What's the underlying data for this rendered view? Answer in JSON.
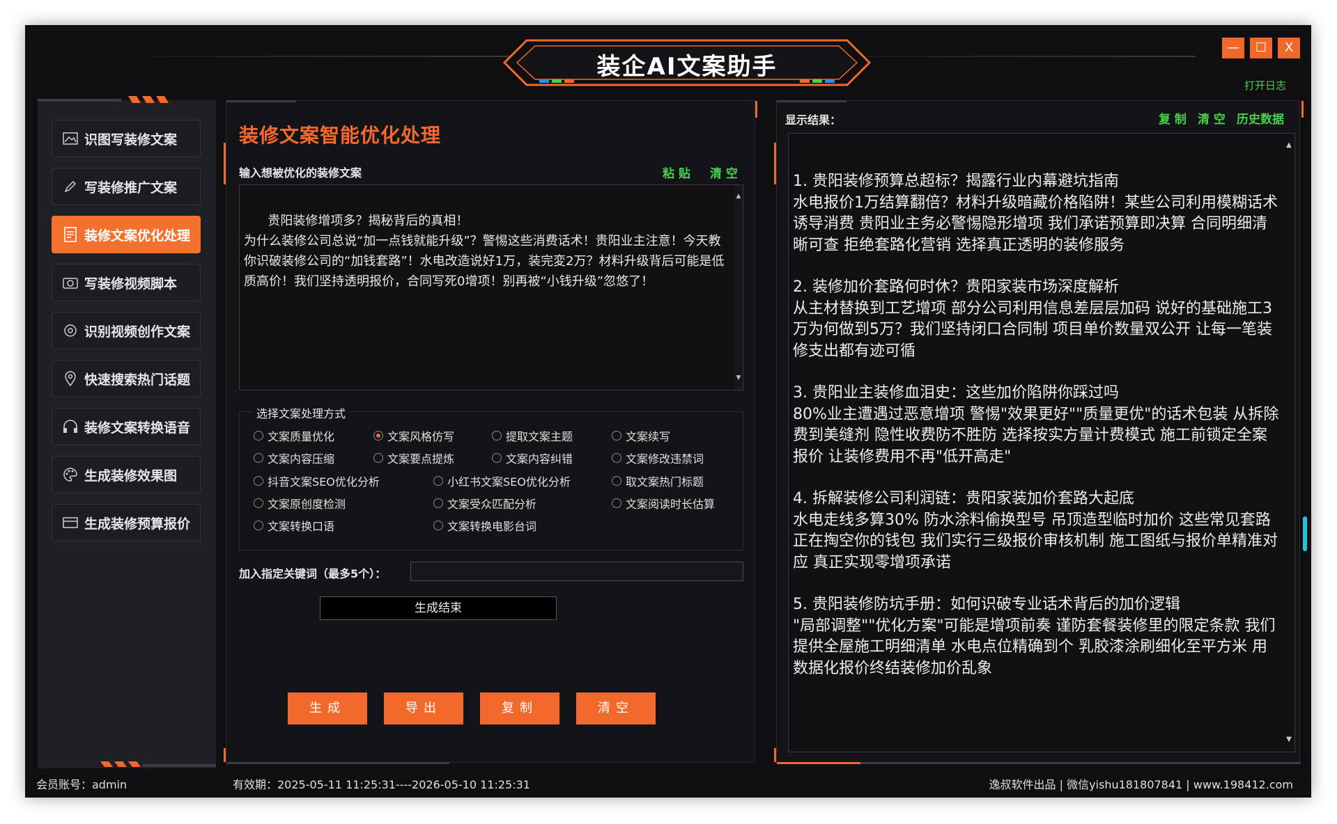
{
  "app": {
    "title": "装企AI文案助手",
    "open_log": "打开日志",
    "window_buttons": {
      "minimize": "—",
      "maximize": "☐",
      "close": "X"
    },
    "accent_color": "#f2692b",
    "green_color": "#46d14a"
  },
  "sidebar": {
    "items": [
      {
        "label": "识图写装修文案",
        "icon": "image-icon"
      },
      {
        "label": "写装修推广文案",
        "icon": "pen-icon"
      },
      {
        "label": "装修文案优化处理",
        "icon": "document-icon",
        "active": true
      },
      {
        "label": "写装修视频脚本",
        "icon": "camera-icon"
      },
      {
        "label": "识别视频创作文案",
        "icon": "settings-icon"
      },
      {
        "label": "快速搜索热门话题",
        "icon": "location-icon"
      },
      {
        "label": "装修文案转换语音",
        "icon": "headphones-icon"
      },
      {
        "label": "生成装修效果图",
        "icon": "palette-icon"
      },
      {
        "label": "生成装修预算报价",
        "icon": "calculator-icon"
      }
    ]
  },
  "center": {
    "title": "装修文案智能优化处理",
    "input_label": "输入想被优化的装修文案",
    "paste": "粘 贴",
    "clear": "清 空",
    "input_text": "贵阳装修增项多？揭秘背后的真相！\n为什么装修公司总说“加一点钱就能升级”？警惕这些消费话术！贵阳业主注意！今天教你识破装修公司的“加钱套路”！水电改造说好1万，装完変2万？材料升级背后可能是低质高价！我们坚持透明报价，合同写死0增项！别再被“小钱升级”忽悠了！",
    "group_title": "选择文案处理方式",
    "options": [
      "文案质量优化",
      "文案风格仿写",
      "提取文案主题",
      "文案续写",
      "文案内容压缩",
      "文案要点提炼",
      "文案内容纠错",
      "文案修改违禁词",
      "抖音文案SEO优化分析",
      "小红书文案SEO优化分析",
      "取文案热门标题",
      "文案原创度检测",
      "文案受众匹配分析",
      "文案阅读时长估算",
      "文案转换口语",
      "文案转换电影台词"
    ],
    "selected_option": "文案风格仿写",
    "keyword_label": "加入指定关键词（最多5个）：",
    "keyword_value": "",
    "status": "生成结束",
    "buttons": {
      "generate": "生成",
      "export": "导出",
      "copy": "复制",
      "clear": "清空"
    }
  },
  "right": {
    "label": "显示结果：",
    "copy": "复 制",
    "clear": "清 空",
    "history": "历史数据",
    "results": [
      {
        "title": "1. 贵阳装修预算总超标？揭露行业内幕避坑指南",
        "body": "水电报价1万结算翻倍？材料升级暗藏价格陷阱！某些公司利用模糊话术诱导消费 贵阳业主务必警惕隐形增项 我们承诺预算即决算 合同明细清晰可查 拒绝套路化营销 选择真正透明的装修服务"
      },
      {
        "title": "2. 装修加价套路何时休？贵阳家装市场深度解析",
        "body": "从主材替换到工艺增项 部分公司利用信息差层层加码 说好的基础施工3万为何做到5万？我们坚持闭口合同制 项目单价数量双公开 让每一笔装修支出都有迹可循"
      },
      {
        "title": "3. 贵阳业主装修血泪史：这些加价陷阱你踩过吗",
        "body": "80%业主遭遇过恶意增项 警惕\"效果更好\"\"质量更优\"的话术包装 从拆除费到美缝剂 隐性收费防不胜防 选择按实方量计费模式 施工前锁定全案报价 让装修费用不再\"低开高走\""
      },
      {
        "title": "4. 拆解装修公司利润链：贵阳家装加价套路大起底",
        "body": "水电走线多算30% 防水涂料偷换型号 吊顶造型临时加价 这些常见套路正在掏空你的钱包 我们实行三级报价审核机制 施工图纸与报价单精准对应 真正实现零增项承诺"
      },
      {
        "title": "5. 贵阳装修防坑手册：如何识破专业话术背后的加价逻辑",
        "body": "\"局部调整\"\"优化方案\"可能是增项前奏 谨防套餐装修里的限定条款 我们提供全屋施工明细清单 水电点位精确到个 乳胶漆涂刷细化至平方米 用数据化报价终结装修加价乱象"
      }
    ]
  },
  "footer": {
    "account": "会员账号：admin",
    "validity": "有效期：2025-05-11 11:25:31----2026-05-10 11:25:31",
    "credits": "逸叔软件出品 | 微信yishu181807841 | www.198412.com"
  }
}
